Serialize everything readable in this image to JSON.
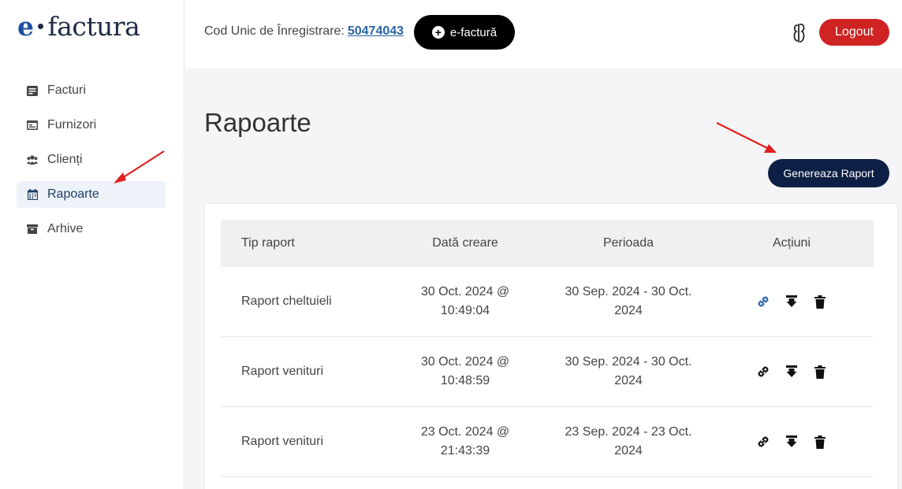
{
  "logo": {
    "prefix": "e",
    "name": "factura"
  },
  "sidebar": {
    "items": [
      {
        "label": "Facturi",
        "icon": "invoice-icon",
        "active": false
      },
      {
        "label": "Furnizori",
        "icon": "supplier-icon",
        "active": false
      },
      {
        "label": "Clienți",
        "icon": "clients-icon",
        "active": false
      },
      {
        "label": "Rapoarte",
        "icon": "calendar-icon",
        "active": true
      },
      {
        "label": "Arhive",
        "icon": "archive-icon",
        "active": false
      }
    ]
  },
  "header": {
    "cui_label": "Cod Unic de Înregistrare:",
    "cui_value": "50474043",
    "efactura_button": "e-factură",
    "logout_button": "Logout"
  },
  "main": {
    "title": "Rapoarte",
    "generate_button": "Genereaza Raport",
    "table": {
      "headers": [
        "Tip raport",
        "Dată creare",
        "Perioada",
        "Acțiuni"
      ],
      "rows": [
        {
          "type": "Raport cheltuieli",
          "created_1": "30 Oct. 2024 @",
          "created_2": "10:49:04",
          "period_1": "30 Sep. 2024 - 30 Oct.",
          "period_2": "2024"
        },
        {
          "type": "Raport venituri",
          "created_1": "30 Oct. 2024 @",
          "created_2": "10:48:59",
          "period_1": "30 Sep. 2024 - 30 Oct.",
          "period_2": "2024"
        },
        {
          "type": "Raport venituri",
          "created_1": "23 Oct. 2024 @",
          "created_2": "21:43:39",
          "period_1": "23 Sep. 2024 - 23 Oct.",
          "period_2": "2024"
        }
      ]
    }
  },
  "colors": {
    "logout": "#d02323",
    "generate": "#0e1f45",
    "efactura": "#000000",
    "link": "#2a64a8",
    "annotation_arrow": "#e02020"
  }
}
